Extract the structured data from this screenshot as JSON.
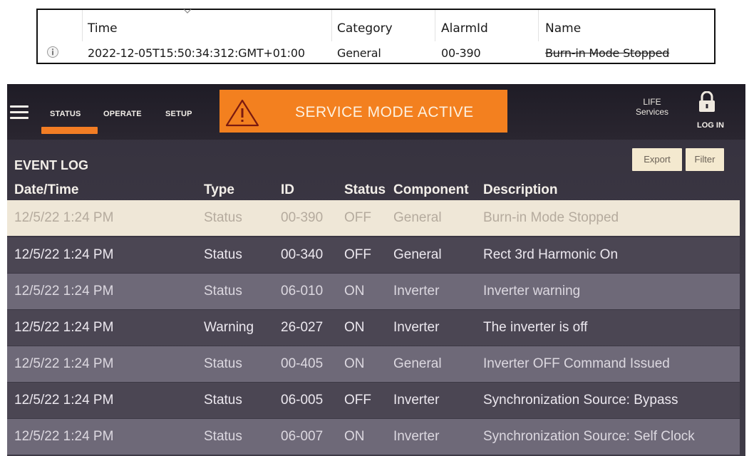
{
  "windows_table": {
    "columns": [
      "Time",
      "Category",
      "AlarmId",
      "Name"
    ],
    "row": {
      "icon": "info-icon",
      "time": "2022-12-05T15:50:34:312:GMT+01:00",
      "category": "General",
      "alarm_id": "00-390",
      "name": "Burn-in Mode Stopped"
    }
  },
  "device": {
    "nav": {
      "menu_icon": "hamburger-menu-icon",
      "tabs": [
        "STATUS",
        "OPERATE",
        "SETUP"
      ],
      "active_tab": "STATUS"
    },
    "banner": {
      "icon": "warning-icon",
      "text": "SERVICE MODE ACTIVE",
      "color": "#f3801f"
    },
    "life": {
      "line1": "LIFE",
      "line2": "Services"
    },
    "login": {
      "icon": "lock-icon",
      "label": "LOG IN"
    },
    "event_log": {
      "title": "EVENT LOG",
      "export_label": "Export",
      "filter_label": "Filter",
      "columns": [
        "Date/Time",
        "Type",
        "ID",
        "Status",
        "Component",
        "Description"
      ],
      "rows": [
        {
          "datetime": "12/5/22 1:24 PM",
          "type": "Status",
          "id": "00-390",
          "status": "OFF",
          "component": "General",
          "description": "Burn-in Mode Stopped"
        },
        {
          "datetime": "12/5/22 1:24 PM",
          "type": "Status",
          "id": "00-340",
          "status": "OFF",
          "component": "General",
          "description": "Rect 3rd Harmonic On"
        },
        {
          "datetime": "12/5/22 1:24 PM",
          "type": "Status",
          "id": "06-010",
          "status": "ON",
          "component": "Inverter",
          "description": "Inverter warning"
        },
        {
          "datetime": "12/5/22 1:24 PM",
          "type": "Warning",
          "id": "26-027",
          "status": "ON",
          "component": "Inverter",
          "description": "The inverter is off"
        },
        {
          "datetime": "12/5/22 1:24 PM",
          "type": "Status",
          "id": "00-405",
          "status": "ON",
          "component": "General",
          "description": "Inverter OFF Command Issued"
        },
        {
          "datetime": "12/5/22 1:24 PM",
          "type": "Status",
          "id": "06-005",
          "status": "OFF",
          "component": "Inverter",
          "description": "Synchronization Source: Bypass"
        },
        {
          "datetime": "12/5/22 1:24 PM",
          "type": "Status",
          "id": "06-007",
          "status": "ON",
          "component": "Inverter",
          "description": "Synchronization Source: Self Clock"
        }
      ]
    }
  }
}
